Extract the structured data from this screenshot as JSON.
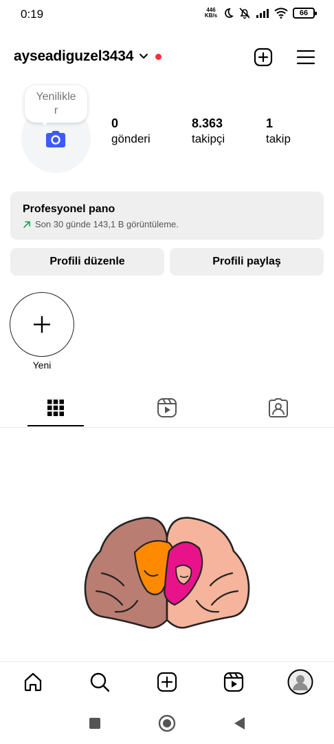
{
  "status_bar": {
    "time": "0:19",
    "net_speed_value": "446",
    "net_speed_unit": "KB/s",
    "battery": "66"
  },
  "header": {
    "username": "ayseadiguzel3434",
    "icons": [
      "chevron-down-icon",
      "notification-dot",
      "create-icon",
      "menu-icon"
    ],
    "notification_color": "#ff2d3f"
  },
  "profile": {
    "note_bubble_line1": "Yenilikle",
    "note_bubble_line2": "r",
    "stats": [
      {
        "value": "0",
        "label": "gönderi"
      },
      {
        "value": "8.363",
        "label": "takipçi"
      },
      {
        "value": "1",
        "label": "takip"
      }
    ],
    "camera_color": "#3d5afe"
  },
  "pro_dashboard": {
    "title": "Profesyonel pano",
    "subtitle": "Son 30 günde 143,1 B görüntüleme.",
    "trend_color": "#1a9e5a"
  },
  "actions": {
    "edit_label": "Profili düzenle",
    "share_label": "Profili paylaş"
  },
  "highlights": {
    "new_label": "Yeni"
  },
  "tabs": [
    "grid-icon",
    "reels-icon",
    "tagged-icon"
  ],
  "bottom_nav": [
    "home-icon",
    "search-icon",
    "create-icon",
    "reels-icon",
    "profile-icon"
  ],
  "system_nav": [
    "recents-icon",
    "home-icon",
    "back-icon"
  ]
}
